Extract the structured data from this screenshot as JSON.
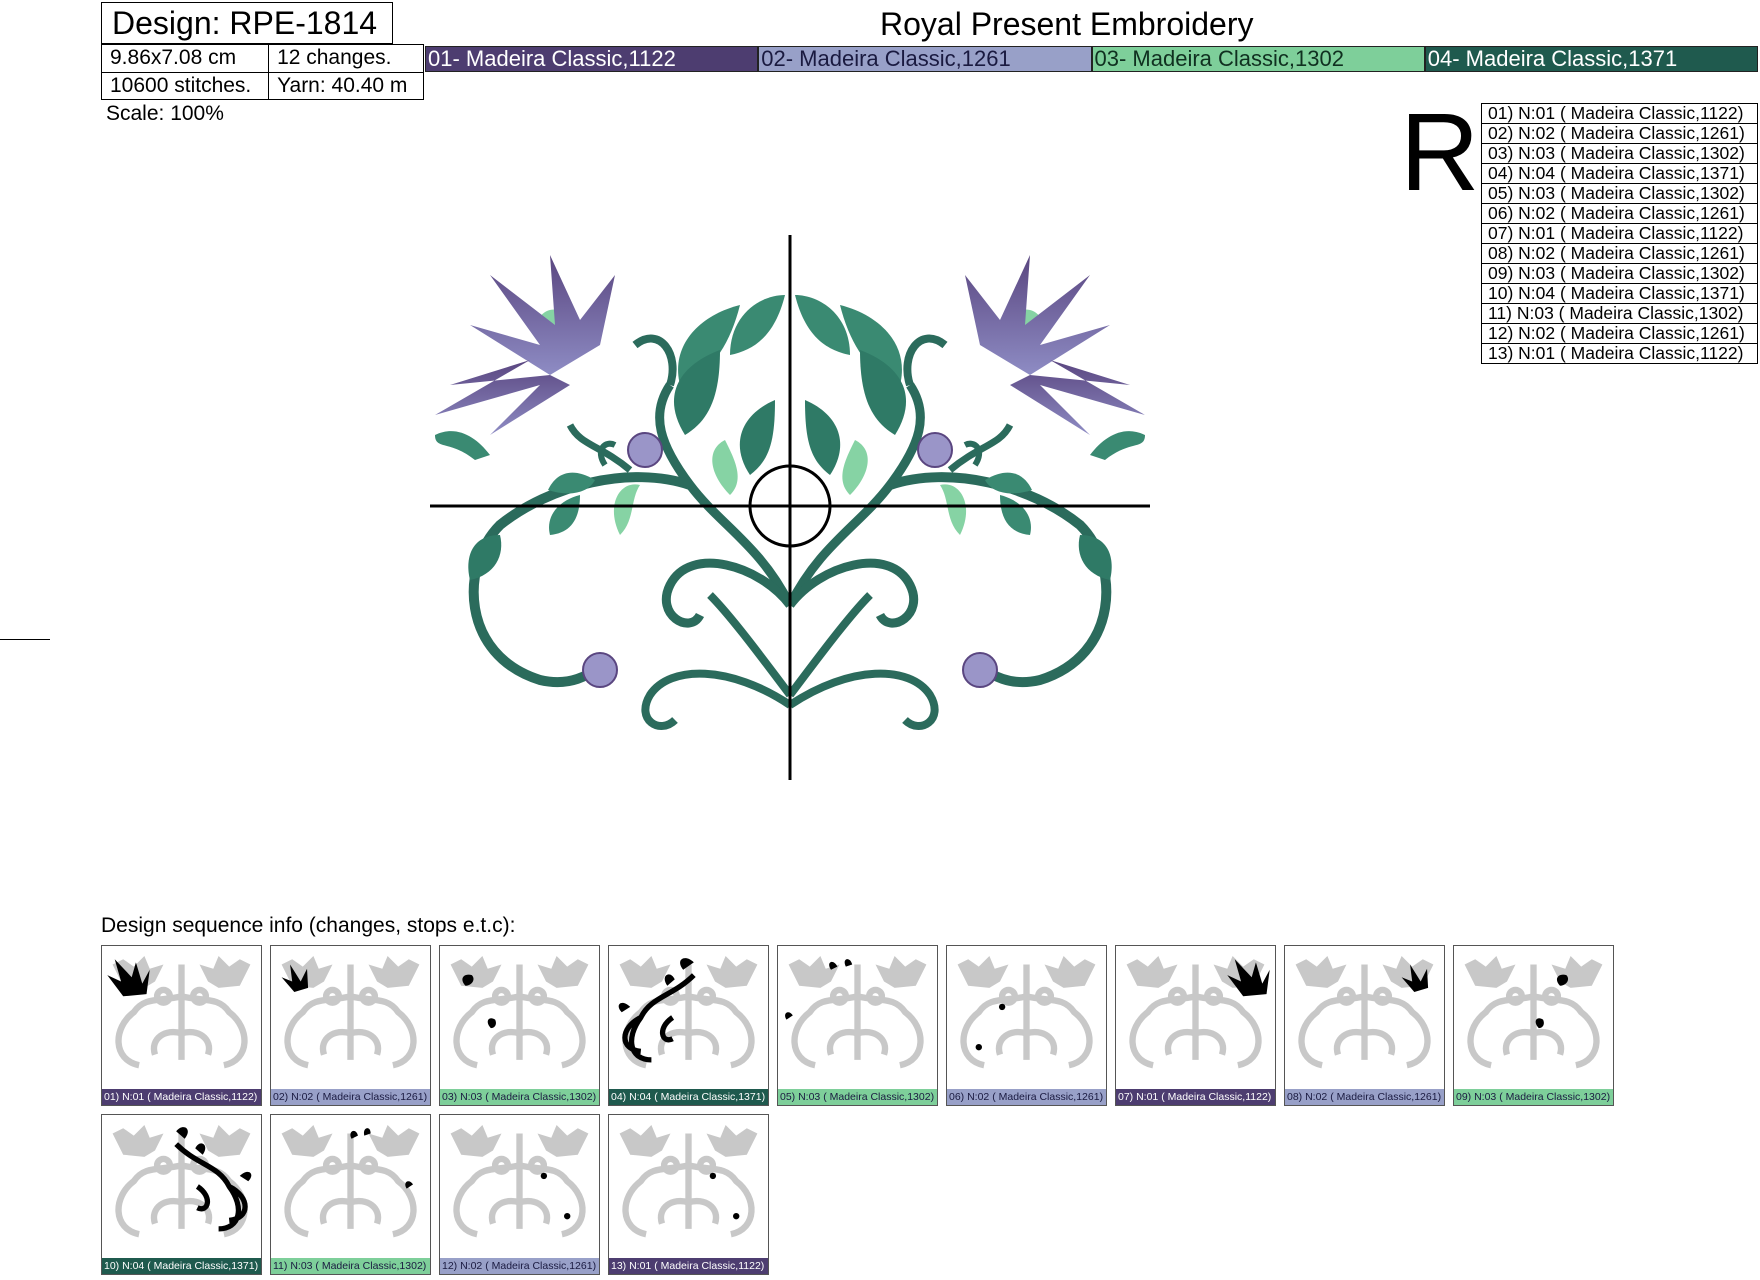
{
  "design": {
    "title": "Design: RPE-1814",
    "size": "9.86x7.08 cm",
    "changes": "12 changes.",
    "stitches": "10600 stitches.",
    "yarn": "Yarn: 40.40 m",
    "scale": "Scale: 100%"
  },
  "company": "Royal Present Embroidery",
  "colors": [
    {
      "label": "01- Madeira Classic,1122",
      "hex": "#4d3d70",
      "text": "#ffffff"
    },
    {
      "label": "02- Madeira Classic,1261",
      "hex": "#98a0c8",
      "text": "#1a1a40"
    },
    {
      "label": "03- Madeira Classic,1302",
      "hex": "#7ecf9a",
      "text": "#103020"
    },
    {
      "label": "04- Madeira Classic,1371",
      "hex": "#1f5a4e",
      "text": "#ffffff"
    }
  ],
  "r_marker": "R",
  "sequence": [
    "01) N:01 ( Madeira Classic,1122)",
    "02) N:02 ( Madeira Classic,1261)",
    "03) N:03 ( Madeira Classic,1302)",
    "04) N:04 ( Madeira Classic,1371)",
    "05) N:03 ( Madeira Classic,1302)",
    "06) N:02 ( Madeira Classic,1261)",
    "07) N:01 ( Madeira Classic,1122)",
    "08) N:02 ( Madeira Classic,1261)",
    "09) N:03 ( Madeira Classic,1302)",
    "10) N:04 ( Madeira Classic,1371)",
    "11) N:03 ( Madeira Classic,1302)",
    "12) N:02 ( Madeira Classic,1261)",
    "13) N:01 ( Madeira Classic,1122)"
  ],
  "sequence_heading": "Design sequence info (changes, stops e.t.c):",
  "thumbnails": [
    {
      "caption": "01) N:01 ( Madeira Classic,1122)",
      "color_index": 0,
      "highlight": "flower-left"
    },
    {
      "caption": "02) N:02 ( Madeira Classic,1261)",
      "color_index": 1,
      "highlight": "petals-left"
    },
    {
      "caption": "03) N:03 ( Madeira Classic,1302)",
      "color_index": 2,
      "highlight": "buds-left"
    },
    {
      "caption": "04) N:04 ( Madeira Classic,1371)",
      "color_index": 3,
      "highlight": "vine-left"
    },
    {
      "caption": "05) N:03 ( Madeira Classic,1302)",
      "color_index": 2,
      "highlight": "leaves-left"
    },
    {
      "caption": "06) N:02 ( Madeira Classic,1261)",
      "color_index": 1,
      "highlight": "dots-left"
    },
    {
      "caption": "07) N:01 ( Madeira Classic,1122)",
      "color_index": 0,
      "highlight": "flower-right"
    },
    {
      "caption": "08) N:02 ( Madeira Classic,1261)",
      "color_index": 1,
      "highlight": "petals-right"
    },
    {
      "caption": "09) N:03 ( Madeira Classic,1302)",
      "color_index": 2,
      "highlight": "buds-right"
    },
    {
      "caption": "10) N:04 ( Madeira Classic,1371)",
      "color_index": 3,
      "highlight": "vine-right"
    },
    {
      "caption": "11) N:03 ( Madeira Classic,1302)",
      "color_index": 2,
      "highlight": "leaves-right"
    },
    {
      "caption": "12) N:02 ( Madeira Classic,1261)",
      "color_index": 1,
      "highlight": "dots-right"
    },
    {
      "caption": "13) N:01 ( Madeira Classic,1122)",
      "color_index": 0,
      "highlight": "dots-right-2"
    }
  ]
}
